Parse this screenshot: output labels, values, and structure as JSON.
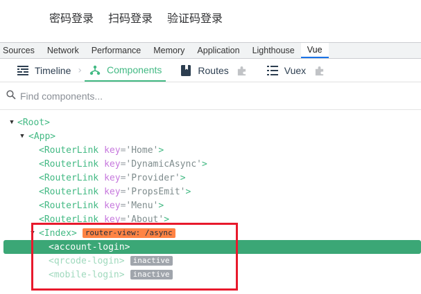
{
  "app": {
    "login_tabs": [
      "密码登录",
      "扫码登录",
      "验证码登录"
    ]
  },
  "devtools": {
    "tabs": [
      "Sources",
      "Network",
      "Performance",
      "Memory",
      "Application",
      "Lighthouse",
      "Vue"
    ],
    "active_tab": "Vue"
  },
  "vue_devtools": {
    "tabs": [
      {
        "label": "Timeline",
        "icon": "timeline-icon"
      },
      {
        "label": "Components",
        "icon": "components-icon",
        "active": true
      },
      {
        "label": "Routes",
        "icon": "routes-icon"
      },
      {
        "label": "Vuex",
        "icon": "vuex-icon"
      }
    ],
    "search_placeholder": "Find components...",
    "accent_color": "#42b983"
  },
  "tree": {
    "root": "<Root>",
    "app": "<App>",
    "router_links": [
      {
        "tag": "<RouterLink",
        "key_name": "key",
        "key_value": "'Home'",
        "close": ">"
      },
      {
        "tag": "<RouterLink",
        "key_name": "key",
        "key_value": "'DynamicAsync'",
        "close": ">"
      },
      {
        "tag": "<RouterLink",
        "key_name": "key",
        "key_value": "'Provider'",
        "close": ">"
      },
      {
        "tag": "<RouterLink",
        "key_name": "key",
        "key_value": "'PropsEmit'",
        "close": ">"
      },
      {
        "tag": "<RouterLink",
        "key_name": "key",
        "key_value": "'Menu'",
        "close": ">"
      },
      {
        "tag": "<RouterLink",
        "key_name": "key",
        "key_value": "'About'",
        "close": ">"
      }
    ],
    "index": {
      "tag": "<Index>",
      "badge": "router-view: /async"
    },
    "children": [
      {
        "tag": "<account-login>",
        "selected": true
      },
      {
        "tag": "<qrcode-login>",
        "badge": "inactive"
      },
      {
        "tag": "<mobile-login>",
        "badge": "inactive"
      }
    ]
  }
}
